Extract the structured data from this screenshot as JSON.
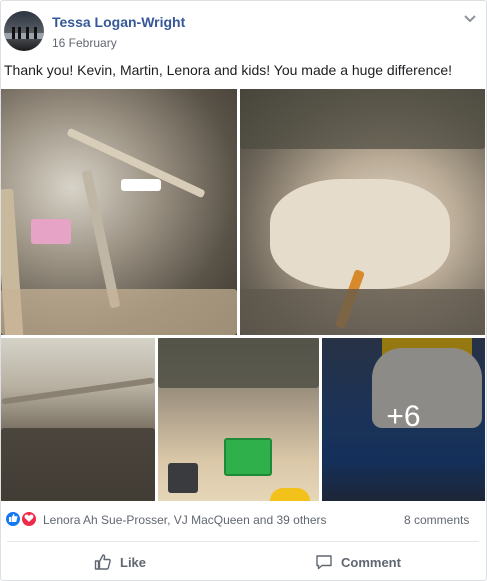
{
  "post": {
    "author": "Tessa Logan-Wright",
    "date": "16 February",
    "message": "Thank you! Kevin, Martin, Lenora and kids! You made a huge difference!",
    "photos": {
      "more_overlay": "+6"
    },
    "reactions": {
      "icons": [
        "like-icon",
        "love-icon"
      ],
      "names": "Lenora Ah Sue-Prosser, VJ MacQueen and 39 others",
      "comments": "8 comments"
    },
    "actions": {
      "like_label": "Like",
      "comment_label": "Comment"
    }
  },
  "colors": {
    "author_link": "#365899",
    "meta_text": "#616770",
    "like_blue": "#1877f2",
    "love_red": "#f0284a"
  }
}
